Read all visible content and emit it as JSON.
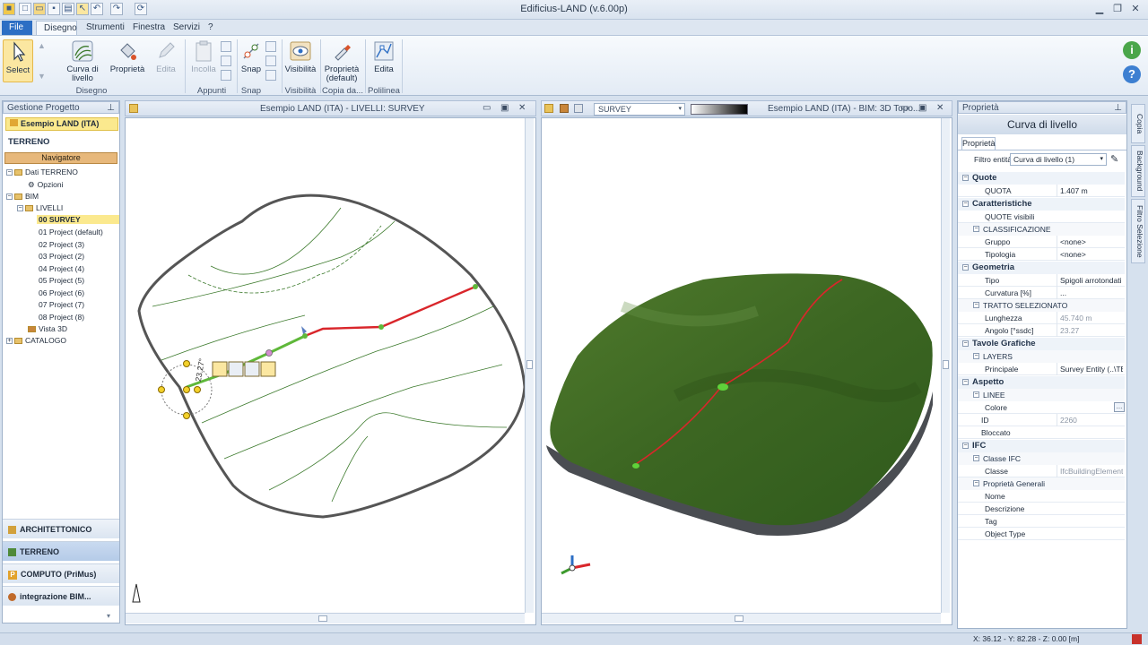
{
  "window": {
    "title": "Edificius-LAND (v.6.00p)"
  },
  "tabs": [
    "File",
    "Disegno",
    "Strumenti",
    "Finestra",
    "Servizi",
    "?"
  ],
  "ribbon": {
    "select": "Select",
    "curva": "Curva di livello",
    "proprieta": "Proprietà",
    "edita": "Edita",
    "incolla": "Incolla",
    "snap": "Snap",
    "visibilita": "Visibilità",
    "proprieta_default": "Proprietà (default)",
    "edita2": "Edita",
    "groups": {
      "disegno": "Disegno",
      "appunti": "Appunti",
      "snap": "Snap",
      "visibilita": "Visibilità",
      "copia": "Copia da...",
      "polilinea": "Polilinea"
    }
  },
  "left_panel": {
    "header": "Gestione Progetto",
    "project": "Esempio LAND (ITA)",
    "section": "TERRENO",
    "navigator": "Navigatore",
    "tree": {
      "dati": "Dati TERRENO",
      "opzioni": "Opzioni",
      "bim": "BIM",
      "livelli": "LIVELLI",
      "levels": [
        "00 SURVEY",
        "01 Project (default)",
        "02 Project (3)",
        "03 Project (2)",
        "04 Project (4)",
        "05 Project (5)",
        "06 Project (6)",
        "07 Project (7)",
        "08 Project (8)"
      ],
      "vista3d": "Vista 3D",
      "catalogo": "CATALOGO"
    },
    "bottom": [
      "ARCHITETTONICO",
      "TERRENO",
      "COMPUTO (PriMus)",
      "integrazione BIM..."
    ]
  },
  "viewport2d": {
    "title": "Esempio LAND (ITA) - LIVELLI: SURVEY",
    "angle_label": "23.27°"
  },
  "viewport3d": {
    "layer": "SURVEY",
    "title": "Esempio LAND (ITA) - BIM: 3D Topo..."
  },
  "props": {
    "header": "Proprietà",
    "title": "Curva di livello",
    "tab": "Proprietà",
    "filter_label": "Filtro entità",
    "filter_value": "Curva di livello (1)",
    "cats": {
      "quote": "Quote",
      "caratteristiche": "Caratteristiche",
      "geometria": "Geometria",
      "tavole": "Tavole Grafiche",
      "aspetto": "Aspetto",
      "ifc": "IFC"
    },
    "rows": {
      "quota_k": "QUOTA",
      "quota_v": "1.407 m",
      "quote_vis_k": "QUOTE visibili",
      "classificazione": "CLASSIFICAZIONE",
      "gruppo_k": "Gruppo",
      "gruppo_v": "<none>",
      "tipologia_k": "Tipologia",
      "tipologia_v": "<none>",
      "tipo_k": "Tipo",
      "tipo_v": "Spigoli arrotondati",
      "curvatura_k": "Curvatura [%]",
      "curvatura_v": "...",
      "tratto": "TRATTO SELEZIONATO",
      "lunghezza_k": "Lunghezza",
      "lunghezza_v": "45.740 m",
      "angolo_k": "Angolo [°ssdc]",
      "angolo_v": "23.27",
      "layers": "LAYERS",
      "principale_k": "Principale",
      "principale_v": "Survey Entity (..\\TER",
      "linee": "LINEE",
      "colore_k": "Colore",
      "id_k": "ID",
      "id_v": "2260",
      "bloccato_k": "Bloccato",
      "classe_ifc": "Classe IFC",
      "classe_k": "Classe",
      "classe_v": "IfcBuildingElementProx",
      "prop_generali": "Proprietà Generali",
      "nome_k": "Nome",
      "descrizione_k": "Descrizione",
      "tag_k": "Tag",
      "objtype_k": "Object Type"
    }
  },
  "side_tabs": [
    "Copia",
    "Background",
    "Filtro Selezione"
  ],
  "status": {
    "coords": "X: 36.12 - Y: 82.28 - Z: 0.00 [m]"
  },
  "colors": {
    "accent": "#2c6ec4",
    "selected": "#fbe98e",
    "line_red": "#d9262b",
    "line_green": "#3c7a2c"
  }
}
